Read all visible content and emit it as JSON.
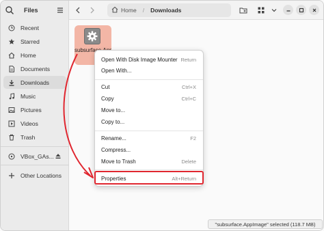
{
  "sidebar": {
    "title": "Files",
    "items": [
      {
        "label": "Recent",
        "icon": "clock-icon"
      },
      {
        "label": "Starred",
        "icon": "star-icon"
      },
      {
        "label": "Home",
        "icon": "home-icon"
      },
      {
        "label": "Documents",
        "icon": "document-icon"
      },
      {
        "label": "Downloads",
        "icon": "download-icon"
      },
      {
        "label": "Music",
        "icon": "music-icon"
      },
      {
        "label": "Pictures",
        "icon": "picture-icon"
      },
      {
        "label": "Videos",
        "icon": "video-icon"
      },
      {
        "label": "Trash",
        "icon": "trash-icon"
      },
      {
        "label": "VBox_GAs...",
        "icon": "disc-icon"
      },
      {
        "label": "Other Locations",
        "icon": "plus-icon"
      }
    ],
    "active_item": "Downloads"
  },
  "header": {
    "path_home": "Home",
    "path_current": "Downloads"
  },
  "file": {
    "label": "subsurface.AppIm..."
  },
  "context_menu": {
    "items": [
      {
        "label": "Open With Disk Image Mounter",
        "accel": "Return"
      },
      {
        "label": "Open With...",
        "accel": ""
      },
      {
        "label": "Cut",
        "accel": "Ctrl+X"
      },
      {
        "label": "Copy",
        "accel": "Ctrl+C"
      },
      {
        "label": "Move to...",
        "accel": ""
      },
      {
        "label": "Copy to...",
        "accel": ""
      },
      {
        "label": "Rename...",
        "accel": "F2"
      },
      {
        "label": "Compress...",
        "accel": ""
      },
      {
        "label": "Move to Trash",
        "accel": "Delete"
      },
      {
        "label": "Properties",
        "accel": "Alt+Return"
      }
    ]
  },
  "status": {
    "text": "\"subsurface.AppImage\" selected (118.7 MB)"
  },
  "colors": {
    "accent_selection": "#f3b6a6",
    "annotation_red": "#e0262f"
  }
}
